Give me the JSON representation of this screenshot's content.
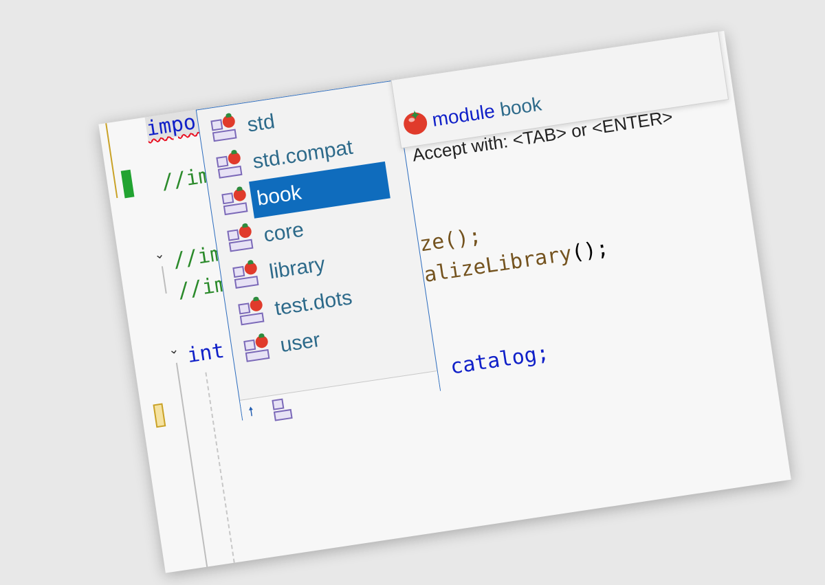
{
  "code": {
    "line1": {
      "keyword": "import",
      "rest": " ;",
      "suffix": "catalog;"
    },
    "comment1": "//im",
    "comment2": "//im",
    "comment3": "//im",
    "call1": "ize();",
    "call2_fn": "ializeLibrary",
    "call2_rest": "();",
    "int_keyword": "int",
    "bottom_line": "og catalog;"
  },
  "completion": {
    "items": [
      {
        "label": "std",
        "icon": "module-icon"
      },
      {
        "label": "std.compat",
        "icon": "module-icon"
      },
      {
        "label": "book",
        "icon": "module-icon",
        "selected": true
      },
      {
        "label": "core",
        "icon": "module-icon"
      },
      {
        "label": "library",
        "icon": "module-icon"
      },
      {
        "label": "test.dots",
        "icon": "module-icon"
      },
      {
        "label": "user",
        "icon": "module-icon"
      }
    ],
    "footer_icons": [
      "pin-icon",
      "module-filter-icon"
    ]
  },
  "tooltip": {
    "kind": "module",
    "name": "book",
    "hint": "Accept with: <TAB> or <ENTER>"
  },
  "colors": {
    "keyword": "#1020c8",
    "comment": "#2b8a2b",
    "selection": "#0f6cbd",
    "module_label": "#2d6a8a"
  }
}
